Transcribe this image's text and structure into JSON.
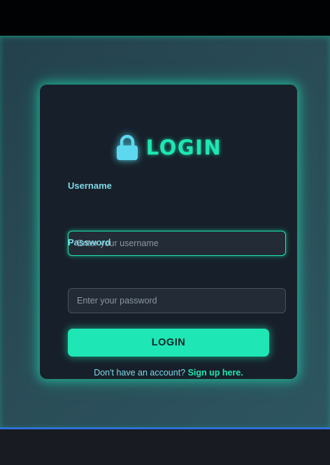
{
  "login": {
    "title": "LOGIN",
    "title_icon": "lock-icon",
    "username": {
      "label": "Username",
      "placeholder": "Enter your username",
      "value": ""
    },
    "password": {
      "label": "Password",
      "placeholder": "Enter your password",
      "value": ""
    },
    "submit_label": "LOGIN",
    "signup_prompt": "Don't have an account? ",
    "signup_link": "Sign up here."
  },
  "colors": {
    "accent": "#1ee6b4",
    "label": "#7fd8e6",
    "card_background": "#17202a",
    "page_background": "#2a4c57",
    "bottom_line": "#2f6fd8"
  }
}
